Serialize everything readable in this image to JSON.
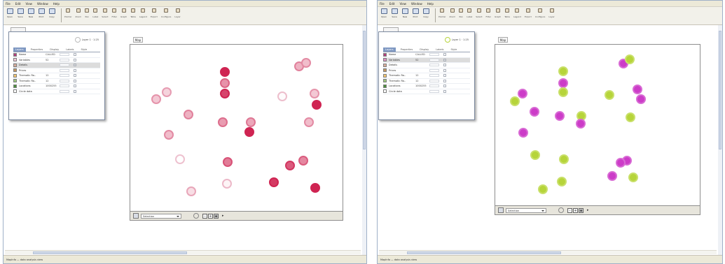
{
  "menu": [
    "File",
    "Edit",
    "View",
    "Window",
    "Help"
  ],
  "toolbar": {
    "large_buttons": [
      "Open",
      "Save",
      "New",
      "Print",
      "Copy"
    ],
    "small_buttons": [
      "Pointer",
      "Zoom",
      "Pan",
      "Label",
      "Select",
      "Filter",
      "Graph",
      "Table",
      "Legend",
      "Export",
      "Configure",
      "Layer"
    ]
  },
  "statusbar_text": "MapInfo — data analysis view",
  "panels": [
    {
      "id": "left",
      "legend": {
        "zoom_text": "Layer 1 · 1:25",
        "tabs": [
          "Layers",
          "Properties",
          "Display",
          "Labels",
          "Style"
        ],
        "rows": [
          {
            "label": "Name",
            "value": "CALLED",
            "swatch": "#b3407f"
          },
          {
            "label": "Variables",
            "value": "52",
            "swatch": "#f0c6d8"
          },
          {
            "label": "Details",
            "value": "",
            "swatch": "#d9ad9a",
            "selected": true
          },
          {
            "label": "Prices",
            "value": "",
            "swatch": "#c4975f"
          },
          {
            "label": "Thematic Ra..",
            "value": "12",
            "swatch": "#f6c66e"
          },
          {
            "label": "Thematic Ra..",
            "value": "12",
            "swatch": "#9bc57a"
          },
          {
            "label": "Locations",
            "value": "1000255",
            "swatch": "#4b8f3c"
          },
          {
            "label": "Circle data",
            "value": "",
            "swatch": "#ffffff"
          }
        ]
      },
      "map": {
        "tab_label": "Map",
        "footer_select": "Selection",
        "points": [
          {
            "x": 2.0,
            "y": 7.6,
            "shade": 0.25
          },
          {
            "x": 3.3,
            "y": 8.1,
            "shade": 0.2
          },
          {
            "x": 3.6,
            "y": 5.0,
            "shade": 0.3
          },
          {
            "x": 6.0,
            "y": 6.5,
            "shade": 0.35
          },
          {
            "x": 5.0,
            "y": 3.2,
            "shade": 0.0
          },
          {
            "x": 6.4,
            "y": 0.8,
            "shade": 0.15
          },
          {
            "x": 10.6,
            "y": 9.6,
            "shade": 1.0
          },
          {
            "x": 10.6,
            "y": 8.8,
            "shade": 0.5
          },
          {
            "x": 10.6,
            "y": 8.0,
            "shade": 0.85
          },
          {
            "x": 10.3,
            "y": 5.9,
            "shade": 0.45
          },
          {
            "x": 10.9,
            "y": 3.0,
            "shade": 0.6
          },
          {
            "x": 10.8,
            "y": 1.4,
            "shade": 0.05
          },
          {
            "x": 13.8,
            "y": 5.9,
            "shade": 0.4
          },
          {
            "x": 13.6,
            "y": 5.2,
            "shade": 1.0
          },
          {
            "x": 17.7,
            "y": 7.8,
            "shade": 0.02
          },
          {
            "x": 19.8,
            "y": 10.0,
            "shade": 0.35
          },
          {
            "x": 20.7,
            "y": 10.3,
            "shade": 0.3
          },
          {
            "x": 21.7,
            "y": 8.0,
            "shade": 0.25
          },
          {
            "x": 22.0,
            "y": 7.2,
            "shade": 1.0
          },
          {
            "x": 21.0,
            "y": 5.9,
            "shade": 0.3
          },
          {
            "x": 20.3,
            "y": 3.1,
            "shade": 0.55
          },
          {
            "x": 18.7,
            "y": 2.7,
            "shade": 0.75
          },
          {
            "x": 16.7,
            "y": 1.5,
            "shade": 0.9
          },
          {
            "x": 21.8,
            "y": 1.1,
            "shade": 1.0
          }
        ]
      }
    },
    {
      "id": "right",
      "legend": {
        "zoom_text": "Layer 1 · 1:25",
        "tabs": [
          "Layers",
          "Properties",
          "Display",
          "Labels",
          "Style"
        ],
        "rows": [
          {
            "label": "Name",
            "value": "CALLED",
            "swatch": "#b3407f"
          },
          {
            "label": "Variables",
            "value": "52",
            "swatch": "#e18bc4",
            "selected": true
          },
          {
            "label": "Details",
            "value": "",
            "swatch": "#d9ad9a"
          },
          {
            "label": "Prices",
            "value": "",
            "swatch": "#c4975f"
          },
          {
            "label": "Thematic Ra..",
            "value": "12",
            "swatch": "#f6c66e"
          },
          {
            "label": "Thematic Ra..",
            "value": "12",
            "swatch": "#9bc57a"
          },
          {
            "label": "Locations",
            "value": "1000255",
            "swatch": "#4b8f3c"
          },
          {
            "label": "Circle data",
            "value": "",
            "swatch": "#ffffff"
          }
        ]
      },
      "map": {
        "tab_label": "Map",
        "footer_select": "Selection",
        "points": [
          {
            "x": 1.3,
            "y": 7.3,
            "category": "green"
          },
          {
            "x": 2.3,
            "y": 7.9,
            "category": "purple"
          },
          {
            "x": 2.4,
            "y": 4.9,
            "category": "purple"
          },
          {
            "x": 3.8,
            "y": 6.5,
            "category": "purple"
          },
          {
            "x": 3.9,
            "y": 3.2,
            "category": "green"
          },
          {
            "x": 4.9,
            "y": 0.6,
            "category": "green"
          },
          {
            "x": 7.5,
            "y": 9.6,
            "category": "green"
          },
          {
            "x": 7.5,
            "y": 8.7,
            "category": "purple"
          },
          {
            "x": 7.5,
            "y": 8.0,
            "category": "green"
          },
          {
            "x": 7.1,
            "y": 6.2,
            "category": "purple"
          },
          {
            "x": 7.6,
            "y": 2.9,
            "category": "green"
          },
          {
            "x": 7.4,
            "y": 1.2,
            "category": "green"
          },
          {
            "x": 9.9,
            "y": 6.2,
            "category": "green"
          },
          {
            "x": 9.8,
            "y": 5.6,
            "category": "purple"
          },
          {
            "x": 13.5,
            "y": 7.8,
            "category": "green"
          },
          {
            "x": 15.4,
            "y": 10.2,
            "category": "purple"
          },
          {
            "x": 16.2,
            "y": 10.5,
            "category": "green"
          },
          {
            "x": 17.2,
            "y": 8.2,
            "category": "purple"
          },
          {
            "x": 17.6,
            "y": 7.5,
            "category": "purple"
          },
          {
            "x": 16.3,
            "y": 6.1,
            "category": "green"
          },
          {
            "x": 15.8,
            "y": 2.8,
            "category": "purple"
          },
          {
            "x": 15.0,
            "y": 2.6,
            "category": "purple"
          },
          {
            "x": 13.9,
            "y": 1.6,
            "category": "purple"
          },
          {
            "x": 16.6,
            "y": 1.5,
            "category": "green"
          }
        ]
      }
    }
  ],
  "colors": {
    "shade_light": "#f3dde5",
    "shade_dark": "#cf2452",
    "purple": "#cc3cc8",
    "green": "#b6d43a",
    "accent": "#7f98c2"
  }
}
